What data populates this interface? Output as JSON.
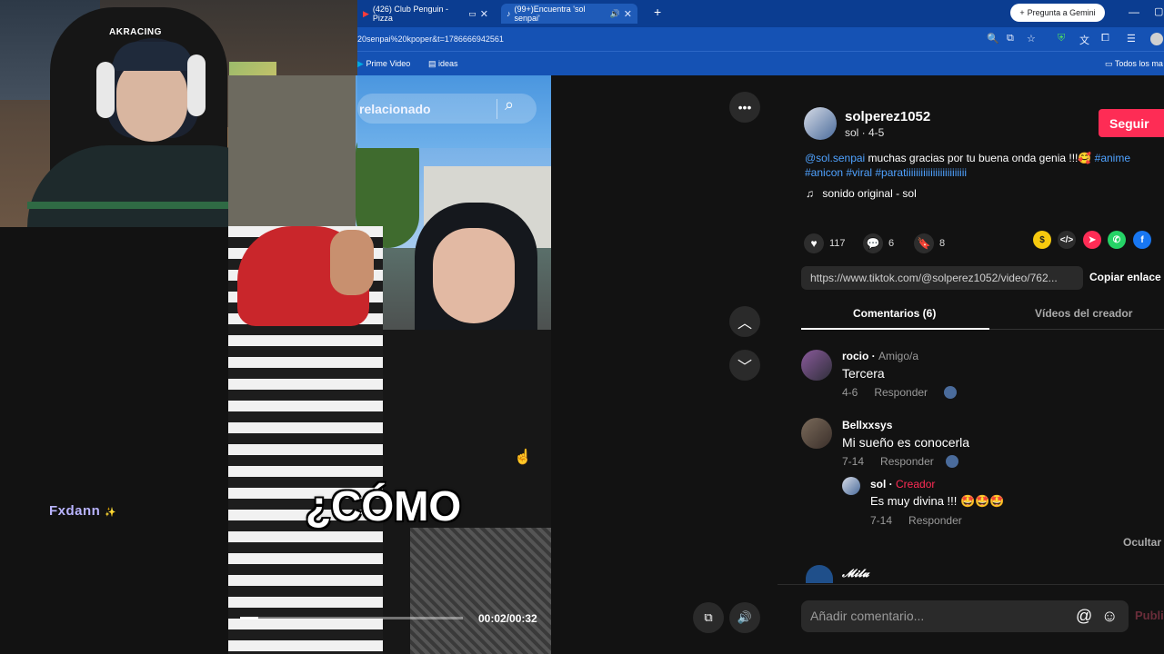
{
  "webcam": {
    "chair_brand": "AKRACING"
  },
  "streamer": {
    "name": "Fxdann",
    "icon": "sparkle-icon"
  },
  "browser": {
    "tabs": [
      {
        "label": "(426) Club Penguin - Pizza",
        "icon": "youtube-icon",
        "active": false
      },
      {
        "label": "(99+)Encuentra 'sol senpai'",
        "icon": "tiktok-icon",
        "active": true
      }
    ],
    "new_tab": "+",
    "gemini_label": "Pregunta a Gemini",
    "url": "20senpai%20kpoper&t=1786666942561",
    "bookmarks": [
      "Prime Video",
      "ideas"
    ],
    "all_bookmarks": "Todos los ma"
  },
  "video": {
    "search_text": "relacionado",
    "caption": "¿CÓMO",
    "time": "00:02/00:32",
    "progress": 0.08
  },
  "post": {
    "author": "solperez1052",
    "author_meta": "sol · 4-5",
    "follow_label": "Seguir",
    "description_mention": "@sol.senpai",
    "description_text": " muchas gracias por tu buena onda genia !!!🥰 ",
    "description_tags": "#anime #anicon #viral #paratiiiiiiiiiiiiiiiiiiiiiiiii",
    "sound": "sonido original - sol",
    "likes": "117",
    "comments": "6",
    "saves": "8",
    "link": "https://www.tiktok.com/@solperez1052/video/762...",
    "copy_link": "Copiar enlace"
  },
  "panel_tabs": {
    "comments": "Comentarios (6)",
    "creator_videos": "Vídeos del creador"
  },
  "comments": [
    {
      "name": "rocio",
      "role": "Amigo/a",
      "text": "Tercera",
      "date": "4-6",
      "reply": "Responder"
    },
    {
      "name": "Bellxxsys",
      "role": "",
      "text": "Mi sueño es conocerla",
      "date": "7-14",
      "reply": "Responder"
    },
    {
      "name": "sol",
      "role": "Creador",
      "text": "Es muy divina !!! 🤩🤩🤩",
      "date": "7-14",
      "reply": "Responder"
    },
    {
      "name": "𝓜𝓲𝓵𝓾",
      "role": "",
      "text": "",
      "date": "",
      "reply": ""
    }
  ],
  "hide_label": "Ocultar",
  "input": {
    "placeholder": "Añadir comentario...",
    "post_label": "Publi"
  }
}
